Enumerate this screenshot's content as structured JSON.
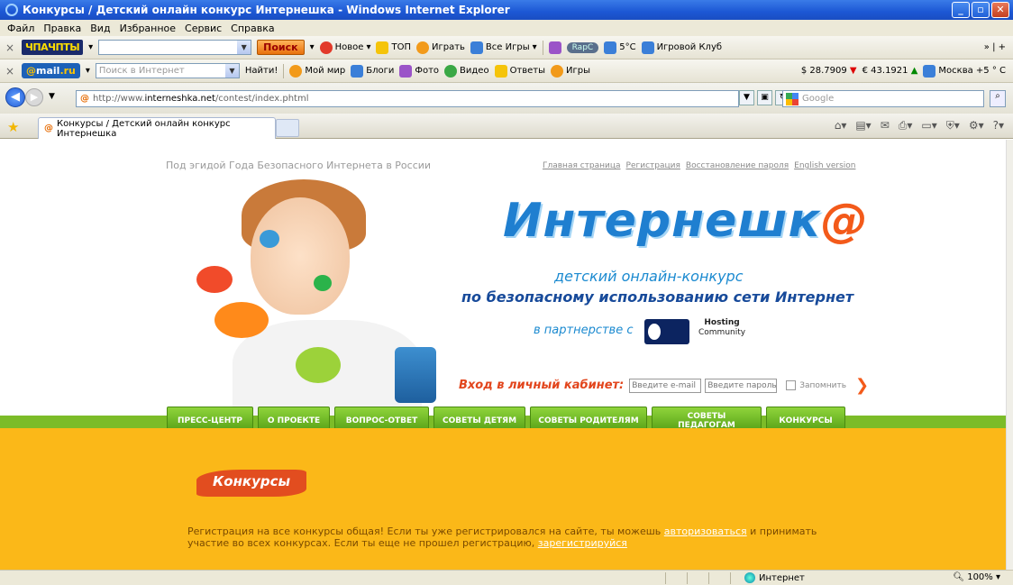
{
  "window": {
    "title": "Конкурсы / Детский онлайн конкурс Интернешка - Windows Internet Explorer"
  },
  "menu": [
    "Файл",
    "Правка",
    "Вид",
    "Избранное",
    "Сервис",
    "Справка"
  ],
  "toolbar1": {
    "brand": "ЧПАЧПТЫ",
    "search_button": "Поиск",
    "items": [
      "Новое",
      "ТОП",
      "Играть",
      "Все Игры"
    ],
    "player": "RapC",
    "weather": "5°C",
    "club": "Игровой Клуб"
  },
  "toolbar2": {
    "brand_prefix": "@",
    "brand_main": "mail",
    "brand_suffix": ".ru",
    "search_placeholder": "Поиск в Интернет",
    "find_button": "Найти!",
    "items": [
      "Мой мир",
      "Блоги",
      "Фото",
      "Видео",
      "Ответы",
      "Игры"
    ],
    "usd": "$ 28.7909",
    "eur": "€ 43.1921",
    "city_weather": "Москва +5 ° C"
  },
  "address": {
    "url_prefix": "http://www.",
    "url_domain": "interneshka.net",
    "url_path": "/contest/index.phtml",
    "search_placeholder": "Google"
  },
  "tab": {
    "title": "Конкурсы / Детский онлайн конкурс Интернешка"
  },
  "page": {
    "top_note": "Под эгидой Года Безопасного Интернета в России",
    "top_links": [
      "Главная страница",
      "Регистрация",
      "Восстановление пароля",
      "English version"
    ],
    "logo_text": "Интернешк",
    "logo_at": "@",
    "subtitle1": "детский онлайн-конкурс",
    "subtitle2": "по безопасному использованию сети Интернет",
    "partner_label": "в партнерстве с",
    "partner2": "Hosting",
    "partner2b": "Community",
    "login_label": "Вход в личный кабинет:",
    "email_placeholder": "Введите e-mail",
    "password_placeholder": "Введите пароль",
    "remember": "Запомнить",
    "nav": [
      "ПРЕСС-ЦЕНТР",
      "О ПРОЕКТЕ",
      "ВОПРОС-ОТВЕТ",
      "СОВЕТЫ ДЕТЯМ",
      "СОВЕТЫ РОДИТЕЛЯМ",
      "СОВЕТЫ ПЕДАГОГАМ",
      "КОНКУРСЫ"
    ],
    "section_title": "Конкурсы",
    "note_part1": "Регистрация на все конкурсы общая! Если ты уже регистрировался на сайте, ты можешь ",
    "note_link1": "авторизоваться",
    "note_part2": " и принимать участие во всех конкурсах. Если ты еще не прошел регистрацию, ",
    "note_link2": "зарегистрируйся"
  },
  "status": {
    "zone": "Интернет",
    "zoom": "100%"
  }
}
